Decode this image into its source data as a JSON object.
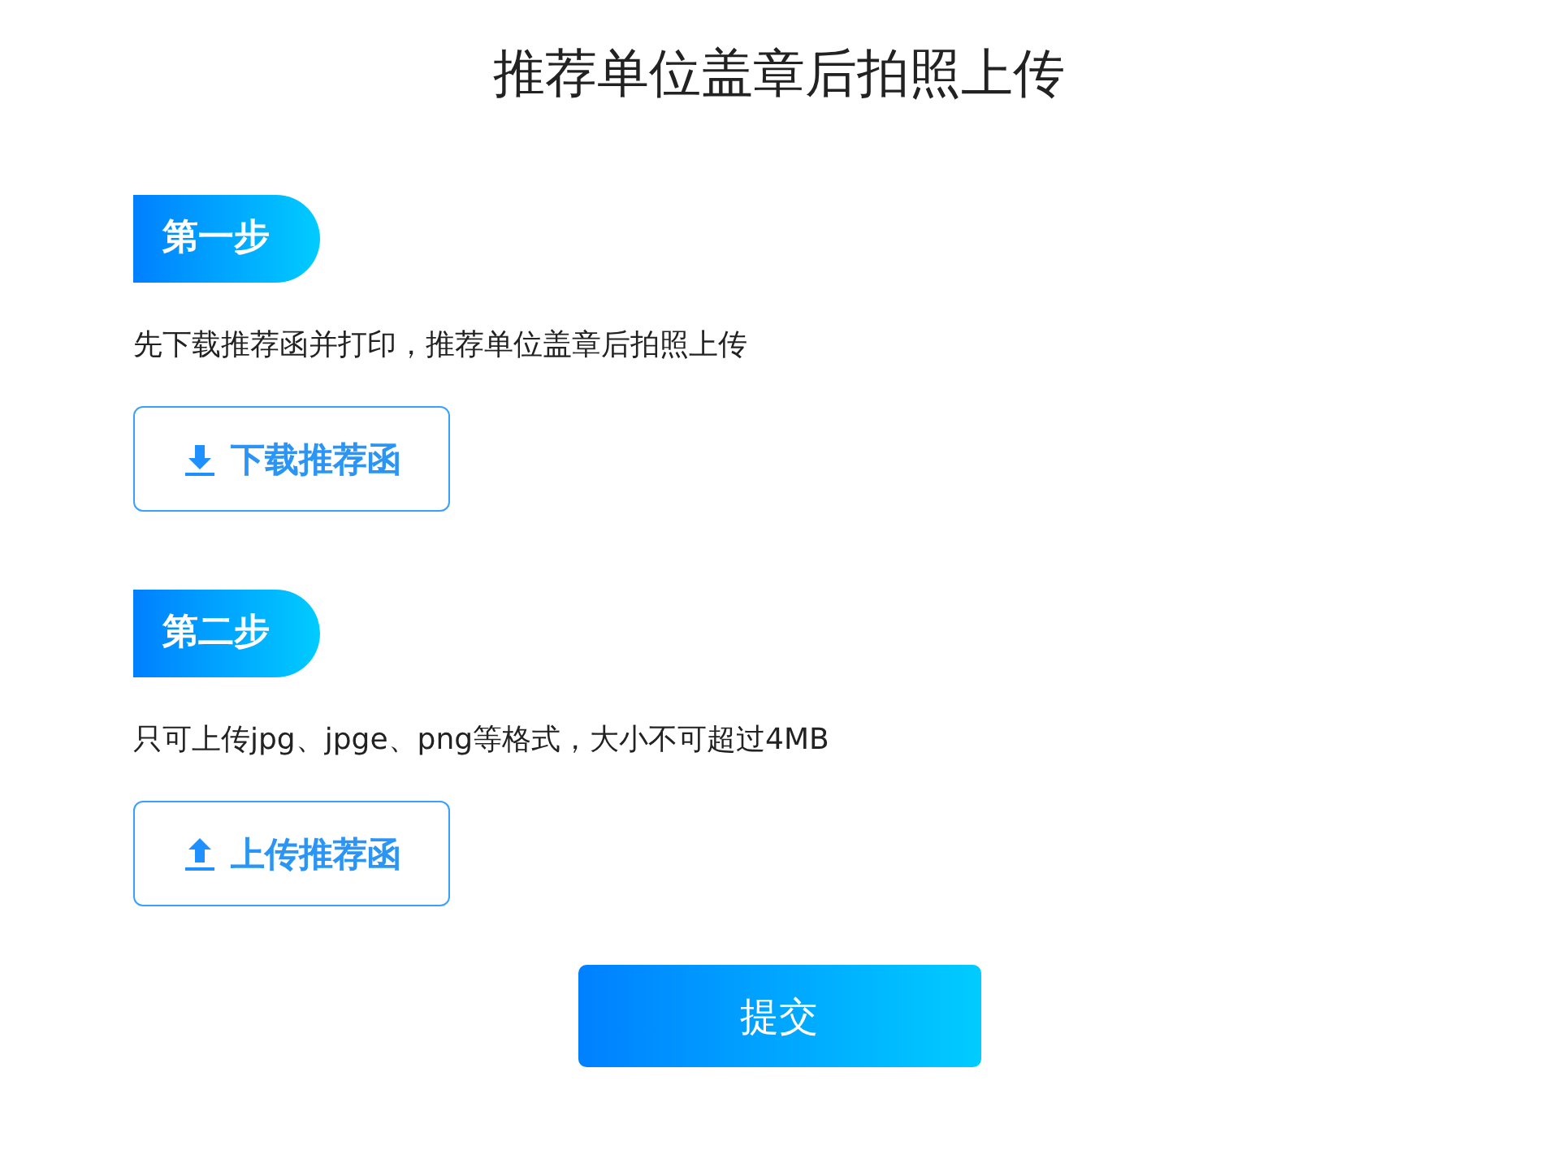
{
  "title": "推荐单位盖章后拍照上传",
  "steps": [
    {
      "badge": "第一步",
      "description": "先下载推荐函并打印，推荐单位盖章后拍照上传",
      "button": {
        "kind": "download",
        "label": "下载推荐函"
      }
    },
    {
      "badge": "第二步",
      "description": "只可上传jpg、jpge、png等格式，大小不可超过4MB",
      "button": {
        "kind": "upload",
        "label": "上传推荐函"
      }
    }
  ],
  "submit": "提交"
}
